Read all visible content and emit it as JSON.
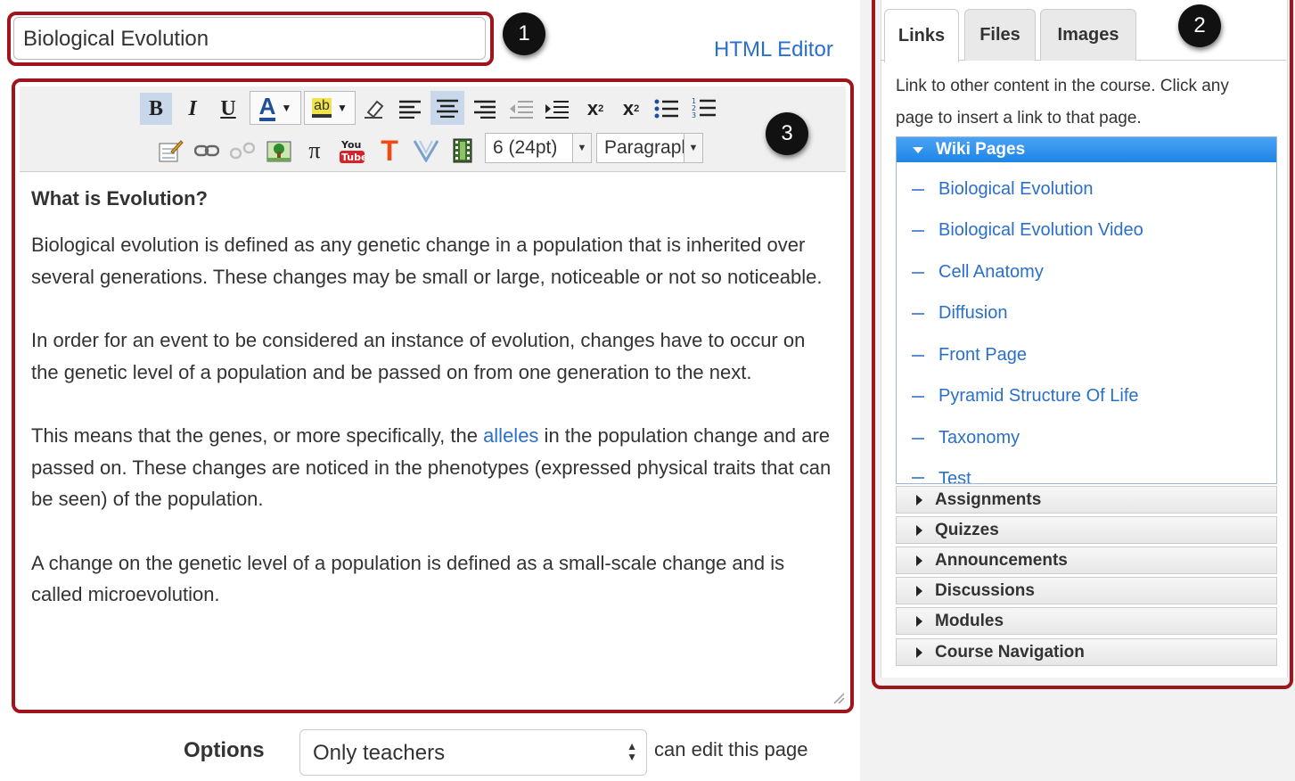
{
  "page": {
    "title_value": "Biological Evolution",
    "html_editor_link": "HTML Editor"
  },
  "markers": [
    "1",
    "2",
    "3"
  ],
  "toolbar": {
    "font_size": "6 (24pt)",
    "block_format": "Paragraph",
    "icons": [
      "bold-icon",
      "italic-icon",
      "underline-icon",
      "font-color-icon",
      "highlight-icon",
      "eraser-icon",
      "align-left-icon",
      "align-center-icon",
      "align-right-icon",
      "outdent-icon",
      "indent-icon",
      "superscript-icon",
      "subscript-icon",
      "bullet-list-icon",
      "numbered-list-icon",
      "edit-table-icon",
      "link-icon",
      "unlink-icon",
      "image-icon",
      "equation-icon",
      "youtube-icon",
      "text-icon",
      "v-icon",
      "media-icon"
    ]
  },
  "content": {
    "heading": "What is Evolution?",
    "p1": "Biological evolution is defined as any genetic change in a population that is inherited over several generations. These changes may be small or large, noticeable or not so noticeable.",
    "p2": "In order for an event to be considered an instance of evolution, changes have to occur on the genetic level of a population and be passed on from one generation to the next.",
    "p3_before": "This means that the genes, or more specifically, the ",
    "p3_link": "alleles",
    "p3_after": " in the population change and are passed on. These changes are noticed in the phenotypes (expressed physical traits that can be seen) of the population.",
    "p4": "A change on the genetic level of a population is defined as a small-scale change and is called microevolution."
  },
  "options": {
    "label": "Options",
    "select_value": "Only teachers",
    "suffix": "can edit this page"
  },
  "sidebar": {
    "tabs": [
      "Links",
      "Files",
      "Images"
    ],
    "intro_line1": "Link to other content in the course. Click any",
    "intro_line2": "page to insert a link to that page.",
    "wiki_header": "Wiki Pages",
    "wiki_pages": [
      "Biological Evolution",
      "Biological Evolution Video",
      "Cell Anatomy",
      "Diffusion",
      "Front Page",
      "Pyramid Structure Of Life",
      "Taxonomy",
      "Test"
    ],
    "sections": [
      "Assignments",
      "Quizzes",
      "Announcements",
      "Discussions",
      "Modules",
      "Course Navigation"
    ]
  }
}
